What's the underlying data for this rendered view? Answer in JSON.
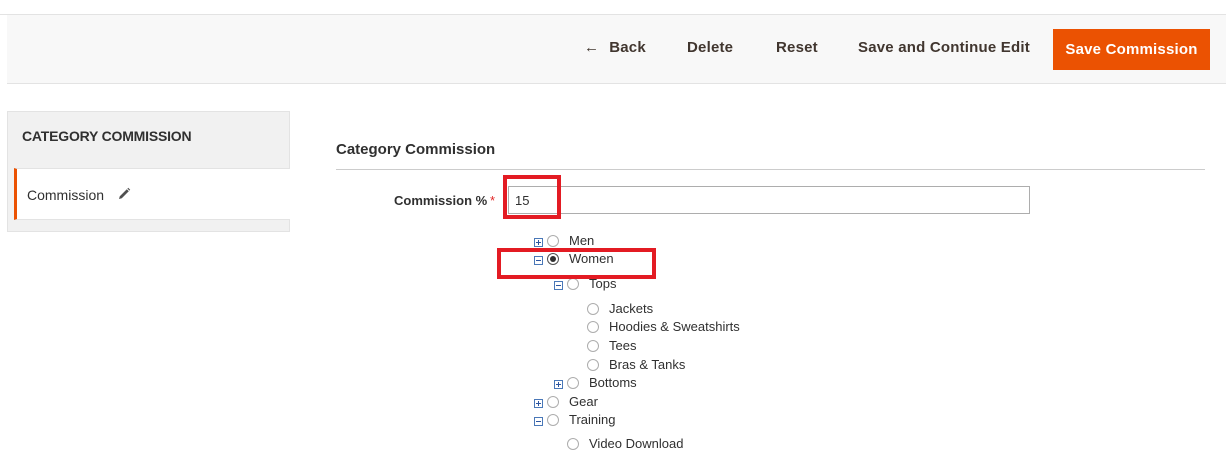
{
  "toolbar": {
    "back_label": "Back",
    "delete_label": "Delete",
    "reset_label": "Reset",
    "save_continue_label": "Save and Continue Edit",
    "save_label": "Save Commission"
  },
  "sidebar": {
    "title": "CATEGORY COMMISSION",
    "items": [
      {
        "label": "Commission"
      }
    ]
  },
  "form": {
    "section_title": "Category Commission",
    "commission_label": "Commission %",
    "required_mark": "*",
    "commission_value": "15"
  },
  "tree": [
    {
      "label": "Men",
      "toggle": "expand",
      "checked": false
    },
    {
      "label": "Women",
      "toggle": "collapse",
      "checked": true
    },
    {
      "label": "Tops",
      "toggle": "collapse",
      "checked": false
    },
    {
      "label": "Jackets",
      "toggle": "none",
      "checked": false
    },
    {
      "label": "Hoodies & Sweatshirts",
      "toggle": "none",
      "checked": false
    },
    {
      "label": "Tees",
      "toggle": "none",
      "checked": false
    },
    {
      "label": "Bras & Tanks",
      "toggle": "none",
      "checked": false
    },
    {
      "label": "Bottoms",
      "toggle": "expand",
      "checked": false
    },
    {
      "label": "Gear",
      "toggle": "expand",
      "checked": false
    },
    {
      "label": "Training",
      "toggle": "collapse",
      "checked": false
    },
    {
      "label": "Video Download",
      "toggle": "none",
      "checked": false
    }
  ],
  "colors": {
    "accent": "#eb5202",
    "highlight": "#e31b23"
  }
}
